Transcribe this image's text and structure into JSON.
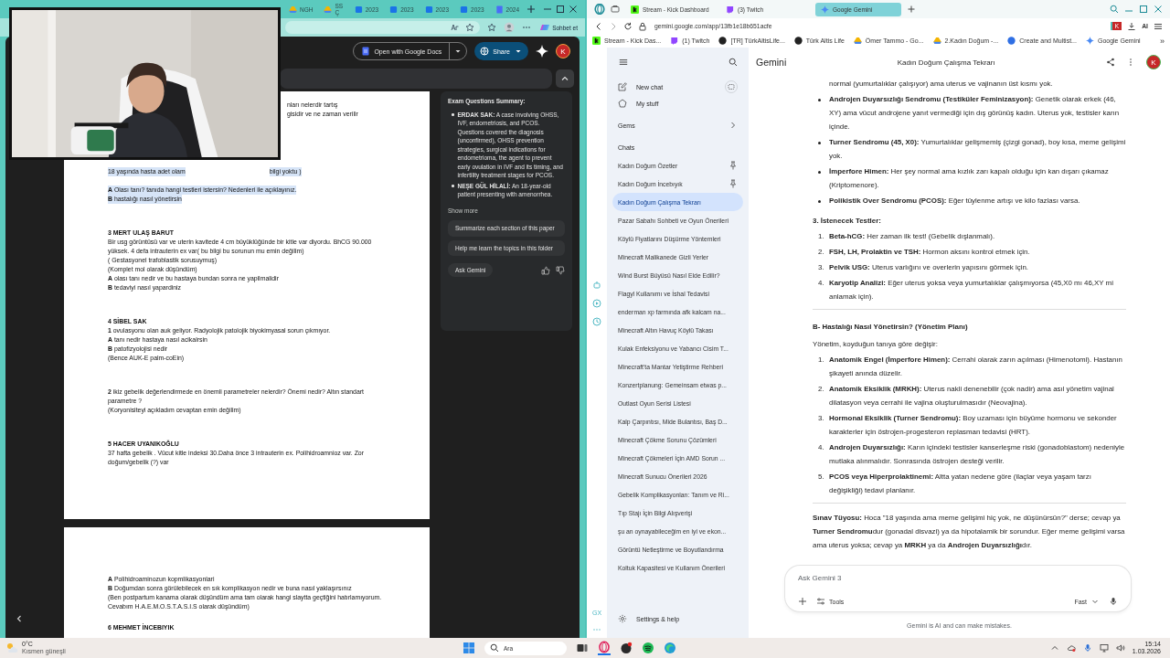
{
  "left_window": {
    "tabs": [
      {
        "label": "NGH",
        "kind": "drive",
        "selected": false
      },
      {
        "label": "SS Ç",
        "kind": "drive",
        "selected": false
      },
      {
        "label": "2023",
        "kind": "files",
        "selected": false
      },
      {
        "label": "2023",
        "kind": "files",
        "selected": false
      },
      {
        "label": "2023",
        "kind": "files",
        "selected": false
      },
      {
        "label": "2023",
        "kind": "files",
        "selected": false
      },
      {
        "label": "2024",
        "kind": "docs",
        "selected": false
      }
    ],
    "chat_button": "Sohbet et",
    "open_with": "Open with Google Docs",
    "share": "Share",
    "avatar": "K",
    "pages": [
      {
        "sections": [
          {
            "kind": "cut",
            "lines": [
              {
                "text": "nları nelerdir tartış",
                "highlighted": false
              },
              {
                "text": "gisidir ve ne zaman verilir",
                "highlighted": false
              }
            ]
          },
          {
            "kind": "plain",
            "lines": [
              {
                "text": "18 yaşında hasta adet olam",
                "after": "bilgi yoktu )",
                "highlighted": true
              },
              {
                "text": "**A** Olası tanı? tanıda hangi testleri istersin? Nedenleri ile açıklayınız.",
                "highlighted": true
              },
              {
                "text": "**B** hastalığı nasıl yönetirsin",
                "highlighted": true
              }
            ]
          },
          {
            "kind": "plain",
            "lines": [
              {
                "text": "**3 MERT ULAŞ BARUT**",
                "highlighted": false
              },
              {
                "text": "Bir usg görüntüsü var ve uterin kavitede 4 cm büyüklüğünde bir kitle var diyordu. BhCG 90.000 yüksek. 4 defa intrauterin ex var( bu bilgi bu sorunun mu emin değilim)",
                "highlighted": false
              },
              {
                "text": "( Gestasyonel trafoblastik sorusuymuş)",
                "highlighted": false
              },
              {
                "text": "(Komplet mol olarak düşündüm)",
                "highlighted": false
              },
              {
                "text": "**A** olası tanı nedir ve bu hastaya bundan sonra ne yapilmalidir",
                "highlighted": false
              },
              {
                "text": "**B** tedaviyi nasıl yapardiniz",
                "highlighted": false
              }
            ]
          },
          {
            "kind": "plain",
            "lines": [
              {
                "text": "**4 SİBEL SAK**",
                "highlighted": false
              },
              {
                "text": "**1** ovulasyonu olan auk geliyor. Radyolojik patolojik biyokimyasal sorun çıkmıyor.",
                "highlighted": false
              },
              {
                "text": "**A** tanı nedir hastaya nasıl acikalrsin",
                "highlighted": false
              },
              {
                "text": "**B** patofizyolojisi nedir",
                "highlighted": false
              },
              {
                "text": "(Bence AUK-E  palm-coEin)",
                "highlighted": false
              }
            ]
          },
          {
            "kind": "plain",
            "lines": [
              {
                "text": "**2** ikiz gebelik değerlendirmede en önemli parametreler nelerdir? Önemi nedir? Altın standart parametre ?",
                "highlighted": false
              },
              {
                "text": "(Koryonisiteyi açıkladım cevaptan emin değilim)",
                "highlighted": false
              }
            ]
          },
          {
            "kind": "plain",
            "lines": [
              {
                "text": "**5 HACER UYANIKOĞLU**",
                "highlighted": false
              },
              {
                "text": "37 hafta gebelik . Vücut kitle indeksi 30.Daha önce 3 intrauterin ex. Polihidroamnioz var. Zor doğum/gebelik (?) var",
                "highlighted": false
              }
            ]
          }
        ]
      },
      {
        "sections": [
          {
            "kind": "plain",
            "lines": [
              {
                "text": "**A** Polihidroaminozun kopmlikasyonlari",
                "highlighted": false
              },
              {
                "text": "**B** Doğumdan sonra görülebilecek en sık komplikasyon nedir ve buna nasıl yaklaşırsınız",
                "highlighted": false
              },
              {
                "text": "(Ben postpartum kanama olarak düşündüm ama tam olarak hangi slaytta geçtiğini hatırlamıyorum. Cevabım H.A.E.M.O.S.T.A.S.I.S olarak düşündüm)",
                "highlighted": false
              }
            ]
          },
          {
            "kind": "plain",
            "lines": [
              {
                "text": "**6 MEHMET İNCEBIYIK**",
                "highlighted": false
              }
            ]
          }
        ]
      }
    ],
    "summary": {
      "title": "Exam Questions Summary:",
      "items": [
        "**ERDAK SAK:** A case involving OHSS, IVF, endometriosis, and PCOS. Questions covered the diagnosis (unconfirmed), OHSS prevention strategies, surgical indications for endometrioma, the agent to prevent early ovulation in IVF and its timing, and infertility treatment stages for PCOS.",
        "**NEŞE GÜL HİLALİ:** An 18-year-old patient presenting with amenorrhea."
      ],
      "show_more": "Show more",
      "suggestions": [
        "Summarize each section of this paper",
        "Help me learn the topics in this folder"
      ],
      "ask": "Ask Gemini"
    }
  },
  "right_window": {
    "tabs": [
      {
        "label": "Stream - Kick Dashboard",
        "kind": "kick",
        "selected": false
      },
      {
        "label": "(3) Twitch",
        "kind": "twitch",
        "selected": false
      },
      {
        "label": "Google Gemini",
        "kind": "gemini",
        "selected": true
      }
    ],
    "url": "gemini.google.com/app/13fb1e18b651acfe",
    "extension_badge": "K",
    "ai_button": "AI",
    "bookmarks": [
      {
        "label": "Stream - Kick Das...",
        "kind": "kick"
      },
      {
        "label": "(1) Twitch",
        "kind": "twitch"
      },
      {
        "label": "[TR] TürkAltisLife...",
        "kind": "dark"
      },
      {
        "label": "Türk Altis Life",
        "kind": "dark"
      },
      {
        "label": "Ömer Tammo - Go...",
        "kind": "drive"
      },
      {
        "label": "2.Kadın Doğum -...",
        "kind": "drive"
      },
      {
        "label": "Create and Multist...",
        "kind": "blue"
      },
      {
        "label": "Google Gemini",
        "kind": "gemini"
      }
    ],
    "more_bookmarks": "»",
    "opera_label": "GX",
    "sidebar": {
      "new_chat": "New chat",
      "my_stuff": "My stuff",
      "gems": "Gems",
      "chats_heading": "Chats",
      "chats": [
        {
          "title": "Kadın Doğum Özetler",
          "pinned": true,
          "selected": false
        },
        {
          "title": "Kadın Doğum İncebıyık",
          "pinned": true,
          "selected": false
        },
        {
          "title": "Kadın Doğum Çalışma Tekrarı",
          "pinned": false,
          "selected": true
        },
        {
          "title": "Pazar Sabahı Sohbeti ve Oyun Önerileri",
          "pinned": false,
          "selected": false
        },
        {
          "title": "Köylü Fiyatlarını Düşürme Yöntemleri",
          "pinned": false,
          "selected": false
        },
        {
          "title": "Minecraft Malikanede Gizli Yerler",
          "pinned": false,
          "selected": false
        },
        {
          "title": "Wind Burst Büyüsü Nasıl Elde Edilir?",
          "pinned": false,
          "selected": false
        },
        {
          "title": "Flagyl Kullanımı ve İshal Tedavisi",
          "pinned": false,
          "selected": false
        },
        {
          "title": "enderman xp farmında afk kalcam na...",
          "pinned": false,
          "selected": false
        },
        {
          "title": "Minecraft Altın Havuç Köylü Takası",
          "pinned": false,
          "selected": false
        },
        {
          "title": "Kulak Enfeksiyonu ve Yabancı Cisim T...",
          "pinned": false,
          "selected": false
        },
        {
          "title": "Minecraft'ta Mantar Yetiştirme Rehberi",
          "pinned": false,
          "selected": false
        },
        {
          "title": "Konzertplanung: Gemeinsam etwas p...",
          "pinned": false,
          "selected": false
        },
        {
          "title": "Outlast Oyun Serisi Listesi",
          "pinned": false,
          "selected": false
        },
        {
          "title": "Kalp Çarpıntısı, Mide Bulantısı, Baş D...",
          "pinned": false,
          "selected": false
        },
        {
          "title": "Minecraft Çökme Sorunu Çözümleri",
          "pinned": false,
          "selected": false
        },
        {
          "title": "Minecraft Çökmeleri İçin AMD Sorun ...",
          "pinned": false,
          "selected": false
        },
        {
          "title": "Minecraft Sunucu Önerileri 2026",
          "pinned": false,
          "selected": false
        },
        {
          "title": "Gebelik Komplikasyonları: Tanım ve Ri...",
          "pinned": false,
          "selected": false
        },
        {
          "title": "Tıp Stajı İçin Bilgi Alışverişi",
          "pinned": false,
          "selected": false
        },
        {
          "title": "şu an oynayabileceğim en iyi ve ekon...",
          "pinned": false,
          "selected": false
        },
        {
          "title": "Görüntü Netleştirme ve Boyutlandırma",
          "pinned": false,
          "selected": false
        },
        {
          "title": "Koltuk Kapasitesi ve Kullanım Önerileri",
          "pinned": false,
          "selected": false
        }
      ],
      "settings": "Settings & help"
    },
    "app_name": "Gemini",
    "title": "Kadın Doğum Çalışma Tekrarı",
    "avatar": "K",
    "content": [
      {
        "kind": "continuation",
        "text": "normal (yumurtalıklar çalışıyor) ama uterus ve vajinanın üst kısmı yok."
      },
      {
        "kind": "bullet",
        "text": "**Androjen Duyarsızlığı Sendromu (Testiküler Feminizasyon):** Genetik olarak erkek (46, XY) ama vücut androjene yanıt vermediği için dış görünüş kadın. Uterus yok, testisler karın içinde."
      },
      {
        "kind": "bullet",
        "text": "**Turner Sendromu (45, X0):** Yumurtalıklar gelişmemiş (çizgi gonad), boy kısa, meme gelişimi yok."
      },
      {
        "kind": "bullet",
        "text": "**İmperfore Himen:** Her şey normal ama kızlık zarı kapalı olduğu için kan dışarı çıkamaz (Kriptomenore)."
      },
      {
        "kind": "bullet",
        "text": "**Polikistik Over Sendromu (PCOS):** Eğer tüylenme artışı ve kilo fazlası varsa."
      },
      {
        "kind": "heading",
        "text": "3. İstenecek Testler:"
      },
      {
        "kind": "numbered",
        "number": "1.",
        "text": "**Beta-hCG:** Her zaman ilk test! (Gebelik dışlanmalı)."
      },
      {
        "kind": "numbered",
        "number": "2.",
        "text": "**FSH, LH, Prolaktin ve TSH:** Hormon aksını kontrol etmek için."
      },
      {
        "kind": "numbered",
        "number": "3.",
        "text": "**Pelvik USG:** Uterus varlığını ve overlerin yapısını görmek için."
      },
      {
        "kind": "numbered",
        "number": "4.",
        "text": "**Karyotip Analizi:** Eğer uterus yoksa veya yumurtalıklar çalışmıyorsa (45,X0 mı 46,XY mi anlamak için)."
      },
      {
        "kind": "rule"
      },
      {
        "kind": "heading",
        "text": "B- Hastalığı Nasıl Yönetirsin? (Yönetim Planı)"
      },
      {
        "kind": "paragraph",
        "text": "Yönetim, koyduğun tanıya göre değişir:"
      },
      {
        "kind": "numbered",
        "number": "1.",
        "text": "**Anatomik Engel (İmperfore Himen):** Cerrahi olarak zarın açılması (Himenotomi). Hastanın şikayeti anında düzelir."
      },
      {
        "kind": "numbered",
        "number": "2.",
        "text": "**Anatomik Eksiklik (MRKH):** Uterus nakli denenebilir (çok nadir) ama asıl yönetim vajinal dilatasyon veya cerrahi ile vajina oluşturulmasıdır (Neovajina)."
      },
      {
        "kind": "numbered",
        "number": "3.",
        "text": "**Hormonal Eksiklik (Turner Sendromu):** Boy uzaması için büyüme hormonu ve sekonder karakterler için östrojen-progesteron replasman tedavisi (HRT)."
      },
      {
        "kind": "numbered",
        "number": "4.",
        "text": "**Androjen Duyarsızlığı:** Karın içindeki testisler kanserleşme riski (gonadoblastom) nedeniyle mutlaka alınmalıdır. Sonrasında östrojen desteği verilir."
      },
      {
        "kind": "numbered",
        "number": "5.",
        "text": "**PCOS veya Hiperprolaktinemi:** Altta yatan nedene göre (ilaçlar veya yaşam tarzı değişikliği) tedavi planlanır."
      },
      {
        "kind": "rule"
      },
      {
        "kind": "paragraph",
        "text": "**Sınav Tüyosu:** Hoca \"18 yaşında ama meme gelişimi hiç yok, ne düşünürsün?\" derse; cevap ya **Turner Sendromu**dur (gonadal disvazi) ya da hipotalamik bir sorundur. Eğer meme gelişimi varsa ama uterus yoksa; cevap ya **MRKH** ya da **Androjen Duyarsızlığı**dır."
      }
    ],
    "input": {
      "placeholder": "Ask Gemini 3",
      "tools": "Tools",
      "mode": "Fast"
    },
    "disclaimer": "Gemini is AI and can make mistakes."
  },
  "taskbar": {
    "temperature": "0°C",
    "weather": "Kısmen güneşli",
    "search": "Ara",
    "time": "15:14",
    "date": "1.03.2026"
  }
}
